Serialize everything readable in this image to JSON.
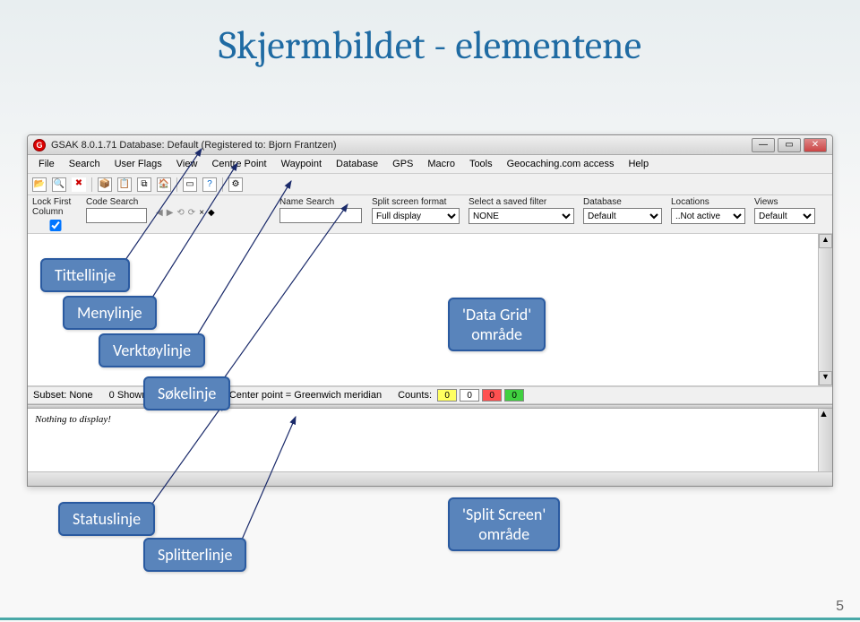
{
  "slide": {
    "title": "Skjermbildet - elementene",
    "pageNumber": "5"
  },
  "window": {
    "title": "GSAK 8.0.1.71    Database: Default    (Registered to: Bjorn Frantzen)"
  },
  "menu": [
    "File",
    "Search",
    "User Flags",
    "View",
    "Centre Point",
    "Waypoint",
    "Database",
    "GPS",
    "Macro",
    "Tools",
    "Geocaching.com access",
    "Help"
  ],
  "search": {
    "lockFirst": "Lock First\nColumn",
    "codeSearch": "Code Search",
    "nameSearch": "Name Search",
    "splitFormatLabel": "Split screen format",
    "splitFormatValue": "Full display",
    "savedFilterLabel": "Select a saved filter",
    "savedFilterValue": "NONE",
    "databaseLabel": "Database",
    "databaseValue": "Default",
    "locationsLabel": "Locations",
    "locationsValue": "..Not active",
    "viewsLabel": "Views",
    "viewsValue": "Default"
  },
  "status": {
    "subset": "Subset: None",
    "shown": "0 Shown (all waypoints)",
    "center": "Center point = Greenwich meridian",
    "countsLabel": "Counts:"
  },
  "counts": [
    {
      "val": "0",
      "bg": "#ffff60"
    },
    {
      "val": "0",
      "bg": "#ffffff"
    },
    {
      "val": "0",
      "bg": "#ff5050"
    },
    {
      "val": "0",
      "bg": "#40d040"
    }
  ],
  "split": {
    "nothing": "Nothing to display!"
  },
  "callouts": {
    "title": "Tittellinje",
    "menu": "Menylinje",
    "tool": "Verktøylinje",
    "search": "Søkelinje",
    "grid": "'Data Grid'\nområde",
    "status": "Statuslinje",
    "splitter": "Splitterlinje",
    "splitscreen": "'Split Screen'\nområde"
  }
}
